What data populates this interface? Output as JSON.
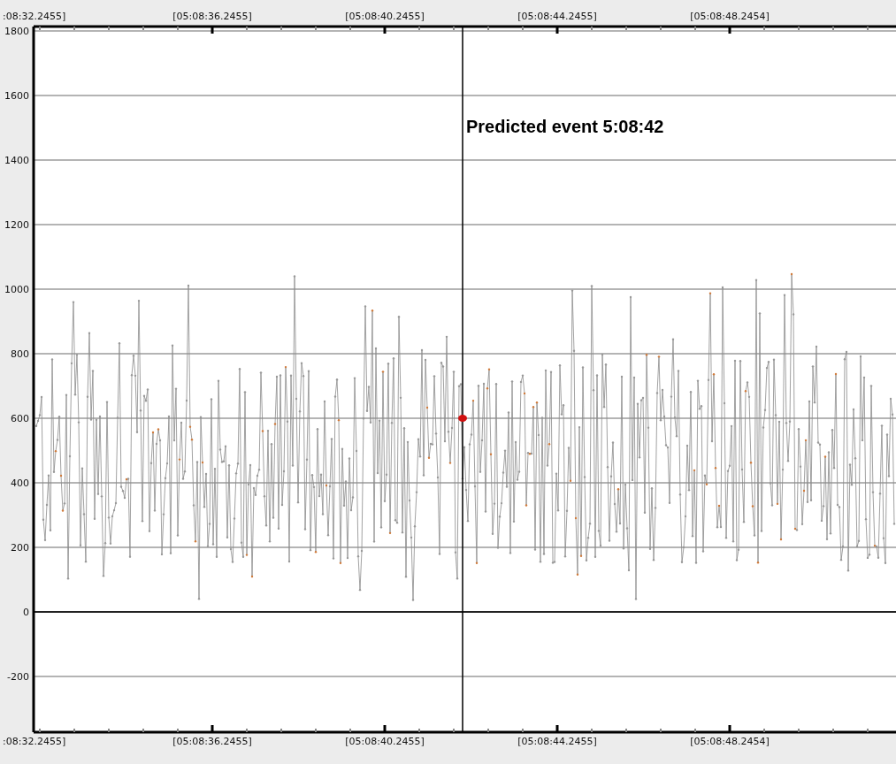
{
  "chart": {
    "y_ticks": [
      "1800",
      "1600",
      "1400",
      "1200",
      "1000",
      "800",
      "600",
      "400",
      "200",
      "0",
      "-200"
    ],
    "top_time_labels": [
      ":08:32.2455]",
      "[05:08:36.2455]",
      "[05:08:40.2455]",
      "[05:08:44.2455]",
      "[05:08:48.2454]"
    ],
    "bottom_time_labels": [
      ":08:32.2455]",
      "[05:08:36.2455]",
      "[05:08:40.2455]",
      "[05:08:44.2455]",
      "[05:08:48.2454]"
    ],
    "event_marker": {
      "label": "Predicted event 5:08:42"
    }
  }
}
